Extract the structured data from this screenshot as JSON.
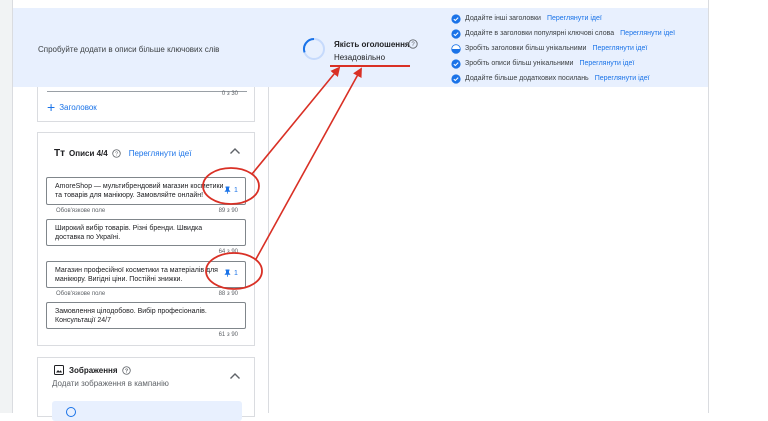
{
  "banner": {
    "hint": "Спробуйте додати в описи більше ключових слів",
    "quality_title": "Якість оголошення",
    "quality_value": "Незадовільно",
    "suggestions": [
      {
        "text": "Додайте інші заголовки",
        "link": "Переглянути ідеї",
        "state": "checked"
      },
      {
        "text": "Додайте в заголовки популярні ключові слова",
        "link": "Переглянути ідеї",
        "state": "checked"
      },
      {
        "text": "Зробіть заголовки більш унікальними",
        "link": "Переглянути ідеї",
        "state": "half"
      },
      {
        "text": "Зробіть описи більш унікальними",
        "link": "Переглянути ідеї",
        "state": "checked"
      },
      {
        "text": "Додайте більше додаткових посилань",
        "link": "Переглянути ідеї",
        "state": "checked"
      }
    ]
  },
  "headlines": {
    "counter": "0 з 30",
    "add_label": "Заголовок"
  },
  "descriptions": {
    "icon_text": "Тт",
    "title": "Описи 4/4",
    "ideas_link": "Переглянути ідеї",
    "required_label": "Обов'язкове поле",
    "items": [
      {
        "value": "AmoreShop — мультибрендовий магазин косметики та товарів для манікюру. Замовляйте онлайн!",
        "counter": "89 з 90",
        "pinned": true,
        "pin_label": "1",
        "required": true
      },
      {
        "value": "Широкий вибір товарів. Різні бренди. Швидка доставка по Україні.",
        "counter": "64 з 90",
        "pinned": false,
        "required": false
      },
      {
        "value": "Магазин професійної косметики та матеріалів для манікюру. Вигідні ціни. Постійні знижки.",
        "counter": "88 з 90",
        "pinned": true,
        "pin_label": "1",
        "required": true
      },
      {
        "value": "Замовлення цілодобово. Вибір професіоналів. Консультації 24/7",
        "counter": "61 з 90",
        "pinned": false,
        "required": false
      }
    ]
  },
  "images": {
    "title": "Зображення",
    "subtitle": "Додати зображення в кампанію"
  },
  "icons": {
    "quality": "progress-ring-icon",
    "help": "help-circle-icon",
    "check": "check-circle-icon",
    "half": "half-circle-icon",
    "pin": "pin-icon",
    "chevron": "chevron-up-icon",
    "image": "image-icon",
    "info": "info-icon"
  },
  "colors": {
    "accent": "#1a73e8",
    "annotation": "#d93025",
    "banner_bg": "#e8f0fe"
  }
}
